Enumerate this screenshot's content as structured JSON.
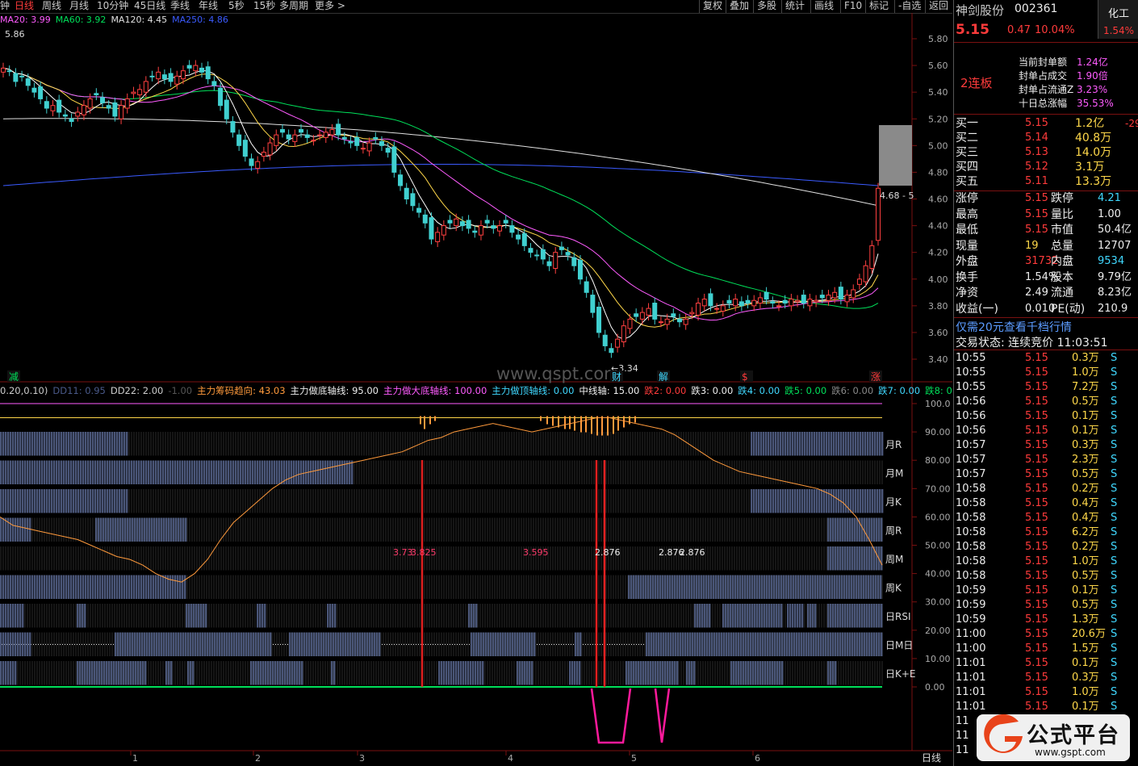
{
  "toolbar": {
    "periods": [
      "钟",
      "日线",
      "周线",
      "月线",
      "10分钟",
      "45日线",
      "季线",
      "年线",
      "5秒",
      "15秒",
      "多周期",
      "更多 >"
    ],
    "active": 1,
    "tools": [
      "复权",
      "叠加",
      "多股",
      "统计",
      "画线",
      "F10",
      "标记",
      "-自选",
      "返回"
    ]
  },
  "ma_legend": [
    {
      "text": "MA20: 3.99",
      "color": "#ff5cff"
    },
    {
      "text": "MA60: 3.92",
      "color": "#00e05a"
    },
    {
      "text": "MA120: 4.45",
      "color": "#e0e0e0"
    },
    {
      "text": "MA250: 4.86",
      "color": "#3b5bff"
    }
  ],
  "price_axis": [
    "5.80",
    "5.60",
    "5.40",
    "5.20",
    "5.00",
    "4.80",
    "4.60",
    "4.40",
    "4.20",
    "4.00",
    "3.80",
    "3.60",
    "3.40"
  ],
  "chart_annotations": {
    "high_label": "5.86",
    "low_label": "3.34",
    "range_label": "4.68 - 5",
    "watermark": "www.qspt.com",
    "markers": [
      {
        "text": "减",
        "color": "#00e05a"
      },
      {
        "text": "财",
        "color": "#40d8ff"
      },
      {
        "text": "解",
        "color": "#40d8ff"
      },
      {
        "text": "$",
        "color": "#ff3b3b"
      },
      {
        "text": "涨",
        "color": "#ff3b3b"
      }
    ]
  },
  "indicator_legend": [
    {
      "text": "0.20,0.10)",
      "color": "#ccc"
    },
    {
      "text": "DD11: 0.95",
      "color": "#4a5a8a"
    },
    {
      "text": "DD22: 2.00",
      "color": "#ccc"
    },
    {
      "text": "-1.00",
      "color": "#555"
    },
    {
      "text": "主力筹码趋向: 43.03",
      "color": "#ff9a3c"
    },
    {
      "text": "主力做底轴线: 95.00",
      "color": "#eee"
    },
    {
      "text": "主力做大底轴线: 100.00",
      "color": "#ff5cff"
    },
    {
      "text": "主力做顶轴线: 0.00",
      "color": "#40d8ff"
    },
    {
      "text": "中线轴: 15.00",
      "color": "#eee"
    },
    {
      "text": "跌2: 0.00",
      "color": "#ff3b3b"
    },
    {
      "text": "跌3: 0.00",
      "color": "#eee"
    },
    {
      "text": "跌4: 0.00",
      "color": "#40d8ff"
    },
    {
      "text": "跌5: 0.00",
      "color": "#00e05a"
    },
    {
      "text": "跌6: 0.00",
      "color": "#888"
    },
    {
      "text": "跌7: 0.00",
      "color": "#40d8ff"
    },
    {
      "text": "跌8: 0",
      "color": "#00e05a"
    }
  ],
  "indicator_axis": [
    "100.0",
    "90.00",
    "80.00",
    "70.00",
    "60.00",
    "50.00",
    "40.00",
    "30.00",
    "20.00",
    "10.00",
    "0.00"
  ],
  "band_labels": [
    "月R",
    "月M",
    "月K",
    "周R",
    "周M",
    "周K",
    "日RSI",
    "日M日",
    "日K+E"
  ],
  "band_values": [
    {
      "text": "3.73",
      "color": "#ff3b6b"
    },
    {
      "text": "3.825",
      "color": "#ff3b6b"
    },
    {
      "text": "3.595",
      "color": "#ff3b6b"
    },
    {
      "text": "2.876",
      "color": "#eee"
    },
    {
      "text": "2.876",
      "color": "#eee"
    },
    {
      "text": "2.876",
      "color": "#eee"
    }
  ],
  "date_axis": [
    "1",
    "2",
    "3",
    "4",
    "5",
    "6"
  ],
  "bottom_tab": "日线",
  "chart_data": [
    {
      "type": "candlestick",
      "ylim": [
        3.3,
        5.9
      ],
      "closes": [
        5.58,
        5.56,
        5.48,
        5.52,
        5.45,
        5.4,
        5.35,
        5.28,
        5.3,
        5.25,
        5.22,
        5.18,
        5.25,
        5.3,
        5.35,
        5.38,
        5.32,
        5.28,
        5.22,
        5.3,
        5.35,
        5.4,
        5.42,
        5.48,
        5.52,
        5.55,
        5.5,
        5.48,
        5.52,
        5.56,
        5.58,
        5.6,
        5.55,
        5.5,
        5.45,
        5.3,
        5.2,
        5.1,
        5.0,
        4.92,
        4.85,
        4.88,
        4.95,
        5.02,
        5.08,
        5.1,
        5.05,
        5.08,
        5.1,
        5.06,
        5.04,
        5.08,
        5.1,
        5.12,
        5.08,
        5.05,
        5.02,
        5.0,
        4.98,
        5.02,
        5.05,
        5.0,
        4.95,
        4.8,
        4.7,
        4.6,
        4.55,
        4.5,
        4.42,
        4.3,
        4.35,
        4.4,
        4.42,
        4.45,
        4.4,
        4.38,
        4.35,
        4.4,
        4.42,
        4.38,
        4.4,
        4.42,
        4.35,
        4.3,
        4.25,
        4.2,
        4.18,
        4.15,
        4.1,
        4.2,
        4.22,
        4.18,
        4.1,
        4.0,
        3.9,
        3.75,
        3.6,
        3.5,
        3.45,
        3.55,
        3.65,
        3.7,
        3.72,
        3.75,
        3.78,
        3.7,
        3.68,
        3.7,
        3.72,
        3.68,
        3.7,
        3.75,
        3.82,
        3.85,
        3.8,
        3.78,
        3.8,
        3.82,
        3.85,
        3.8,
        3.82,
        3.84,
        3.86,
        3.85,
        3.82,
        3.8,
        3.82,
        3.85,
        3.84,
        3.82,
        3.85,
        3.84,
        3.86,
        3.88,
        3.9,
        3.85,
        3.88,
        3.92,
        4.0,
        4.1,
        4.25,
        4.68
      ],
      "series": [
        {
          "name": "MA20",
          "color": "#ff5cff",
          "values": [
            3.99
          ]
        },
        {
          "name": "MA60",
          "color": "#00e05a",
          "values": [
            3.92
          ]
        },
        {
          "name": "MA120",
          "color": "#e0e0e0",
          "values": [
            4.45
          ]
        },
        {
          "name": "MA250",
          "color": "#3b5bff",
          "values": [
            4.86
          ]
        }
      ]
    },
    {
      "type": "line",
      "ylim": [
        0,
        100
      ],
      "series": [
        {
          "name": "主力筹码趋向",
          "color": "#ff9a3c",
          "values": [
            60,
            57,
            56,
            55,
            54,
            53,
            52,
            50,
            48,
            46,
            45,
            43,
            40,
            38,
            37,
            40,
            45,
            52,
            58,
            62,
            66,
            70,
            73,
            75,
            76,
            77,
            78,
            79,
            80,
            81,
            82,
            83,
            85,
            87,
            88,
            90,
            91,
            92,
            93,
            92,
            91,
            90,
            91,
            92,
            93,
            94,
            95,
            95,
            94,
            93,
            92,
            91,
            89,
            86,
            83,
            80,
            78,
            76,
            75,
            74,
            73,
            72,
            71,
            70,
            68,
            65,
            60,
            52,
            43
          ]
        }
      ]
    }
  ]
}
